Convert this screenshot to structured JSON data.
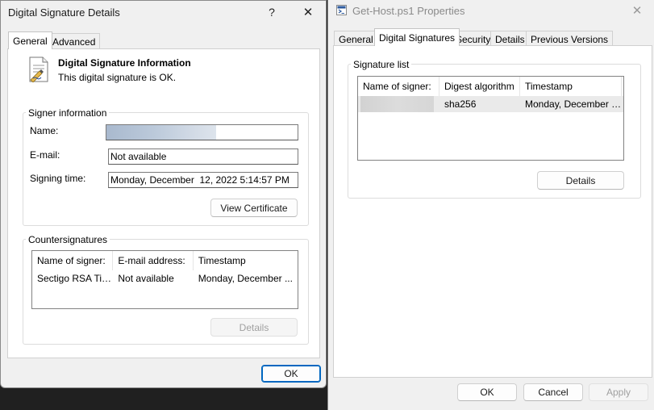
{
  "left_window": {
    "title": "Digital Signature Details",
    "help_glyph": "?",
    "close_glyph": "✕",
    "tabs": [
      {
        "label": "General",
        "active": true
      },
      {
        "label": "Advanced",
        "active": false
      }
    ],
    "info": {
      "icon": "certificate-document-icon",
      "heading": "Digital Signature Information",
      "status": "This digital signature is OK."
    },
    "signer": {
      "group_label": "Signer information",
      "name_label": "Name:",
      "name_value": "",
      "email_label": "E-mail:",
      "email_value": "Not available",
      "time_label": "Signing time:",
      "time_value": "Monday, December  12, 2022 5:14:57 PM",
      "view_cert_label": "View Certificate"
    },
    "countersignatures": {
      "group_label": "Countersignatures",
      "columns": [
        "Name of signer:",
        "E-mail address:",
        "Timestamp"
      ],
      "rows": [
        [
          "Sectigo RSA Tim...",
          "Not available",
          "Monday, December ..."
        ]
      ],
      "details_label": "Details"
    },
    "ok_label": "OK"
  },
  "right_window": {
    "title": "Get-Host.ps1 Properties",
    "close_glyph": "✕",
    "file_icon": "powershell-script-icon",
    "tabs": [
      {
        "label": "General",
        "active": false
      },
      {
        "label": "Digital Signatures",
        "active": true
      },
      {
        "label": "Security",
        "active": false
      },
      {
        "label": "Details",
        "active": false
      },
      {
        "label": "Previous Versions",
        "active": false
      }
    ],
    "signature_list": {
      "group_label": "Signature list",
      "columns": [
        "Name of signer:",
        "Digest algorithm",
        "Timestamp"
      ],
      "rows": [
        [
          "",
          "sha256",
          "Monday, December 1..."
        ]
      ],
      "details_label": "Details"
    },
    "buttons": {
      "ok": "OK",
      "cancel": "Cancel",
      "apply": "Apply"
    }
  },
  "colors": {
    "accent": "#0067c0",
    "window_bg": "#f0f0f0",
    "panel_bg": "#ffffff",
    "desktop_bg": "#202020"
  }
}
